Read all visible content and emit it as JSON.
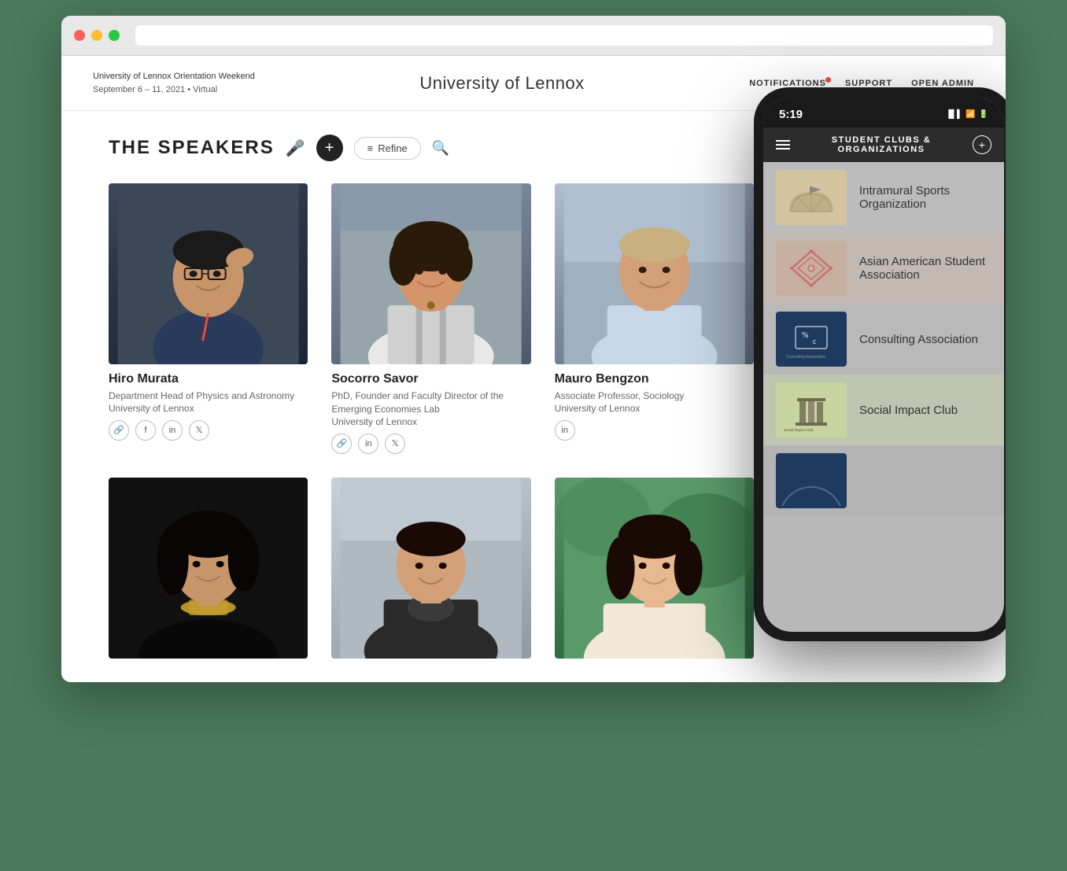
{
  "browser": {
    "dots": [
      "red",
      "yellow",
      "green"
    ]
  },
  "topnav": {
    "event_name": "University of Lennox Orientation Weekend",
    "event_dates": "September 6 – 11, 2021  •  Virtual",
    "site_title": "University of Lennox",
    "notifications_label": "NOTIFICATIONS",
    "support_label": "SUPPORT",
    "open_admin_label": "OPEN ADMIN"
  },
  "speakers": {
    "section_title": "THE SPEAKERS",
    "add_button_label": "+",
    "refine_button_label": "Refine",
    "speakers_list": [
      {
        "name": "Hiro Murata",
        "title": "Department Head of Physics and Astronomy",
        "org": "University of Lennox",
        "socials": [
          "link",
          "facebook",
          "linkedin",
          "twitter"
        ],
        "photo_color": "#4a5568"
      },
      {
        "name": "Socorro Savor",
        "title": "PhD, Founder and Faculty Director of the Emerging Economies Lab",
        "org": "University of Lennox",
        "socials": [
          "link",
          "linkedin",
          "twitter"
        ],
        "photo_color": "#8a7a6a"
      },
      {
        "name": "Mauro Bengzon",
        "title": "Associate Professor, Sociology",
        "org": "University of Lennox",
        "socials": [
          "linkedin"
        ],
        "photo_color": "#a0aec0"
      },
      {
        "name": "",
        "title": "",
        "org": "",
        "socials": [],
        "photo_color": "#777"
      },
      {
        "name": "",
        "title": "",
        "org": "",
        "socials": [],
        "photo_color": "#1a1a1a"
      },
      {
        "name": "",
        "title": "",
        "org": "",
        "socials": [],
        "photo_color": "#4a7a5a"
      }
    ]
  },
  "phone": {
    "time": "5:19",
    "header_title": "STUDENT CLUBS &\nORGANIZATIONS",
    "clubs": [
      {
        "name": "Intramural Sports Organization",
        "logo_bg": "#d4c5a0",
        "logo_type": "intramural"
      },
      {
        "name": "Asian American Student Association",
        "logo_bg": "#c8b0a0",
        "logo_type": "asian"
      },
      {
        "name": "Consulting Association",
        "logo_bg": "#1e3a5f",
        "logo_type": "consulting"
      },
      {
        "name": "Social Impact Club",
        "logo_bg": "#c8d4a0",
        "logo_type": "social"
      }
    ]
  }
}
